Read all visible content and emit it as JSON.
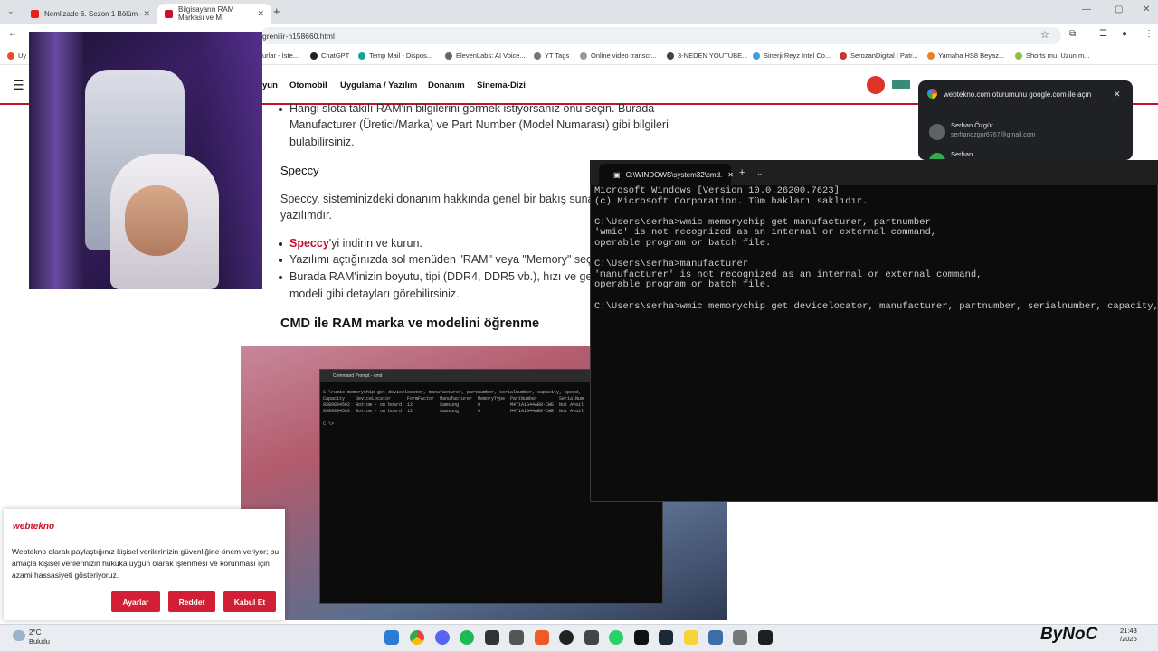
{
  "browser": {
    "tabs": [
      {
        "title": "Nemlizade 6. Sezon 1 Bölüm - ",
        "active": false
      },
      {
        "title": "Bilgisayarın RAM Markası ve M",
        "active": true
      }
    ],
    "url": "grenilir-h158660.html",
    "bookmarks": [
      "Uy",
      "urlar - İste...",
      "ChatGPT",
      "Temp Mail - Dispos...",
      "ElevenLabs: AI Voice...",
      "YT Tags",
      "Online video transcr...",
      "3-NEDEN YOUTUBE...",
      "Sinerji Reyz Intel Co...",
      "SerozanDigital | Patr...",
      "Yamaha HS8 Beyaz...",
      "Shorts mu, Uzun m..."
    ]
  },
  "site": {
    "nav": [
      "yun",
      "Otomobil",
      "Uygulama / Yazılım",
      "Donanım",
      "Sinema-Dizi"
    ],
    "article": {
      "p1_l1": "Hangi slota takılı RAM'in bilgilerini görmek istiyorsanız onu seçin. Burada",
      "p1_l2": "Manufacturer (Üretici/Marka) ve Part Number (Model Numarası) gibi bilgileri",
      "p1_l3": "bulabilirsiniz.",
      "h_speccy": "Speccy",
      "p2_l1": "Speccy, sisteminizdeki donanım hakkında genel bir bakış suna",
      "p2_l2": "yazılımdır.",
      "b1_link": "Speccy",
      "b1_rest": "'yi indirin ve kurun.",
      "b2": "Yazılımı açtığınızda sol menüden \"RAM\" veya \"Memory\" seçe",
      "b3_l1": "Burada RAM'inizin boyutu, tipi (DDR4, DDR5 vb.), hızı ve gen",
      "b3_l2": "modeli gibi detayları görebilirsiniz.",
      "h_cmd": "CMD ile RAM marka ve modelini öğrenme"
    },
    "article_image": {
      "title": "Command Prompt - cmd",
      "lines": [
        "C:\\>wmic memorychip get devicelocator, manufacturer, partnumber, serialnumber, capacity, speed,",
        "Capacity    DeviceLocator      FormFactor  Manufacturer  MemoryType  PartNumber        SerialNum",
        "8589934592  Bottom - on board  12          Samsung       0           M471A1G44AB0-CWE  Not Avail",
        "8589934592  Bottom - on board  12          Samsung       0           M471A1G44AB0-CWE  Not Avail",
        "",
        "C:\\>"
      ]
    }
  },
  "terminal": {
    "tab_title": "C:\\WINDOWS\\system32\\cmd.",
    "lines": [
      "Microsoft Windows [Version 10.0.26200.7623]",
      "(c) Microsoft Corporation. Tüm hakları saklıdır.",
      "",
      "C:\\Users\\serha>wmic memorychip get manufacturer, partnumber",
      "'wmic' is not recognized as an internal or external command,",
      "operable program or batch file.",
      "",
      "C:\\Users\\serha>manufacturer",
      "'manufacturer' is not recognized as an internal or external command,",
      "operable program or batch file.",
      "",
      "C:\\Users\\serha>wmic memorychip get devicelocator, manufacturer, partnumber, serialnumber, capacity, spe"
    ]
  },
  "google_popup": {
    "title": "webtekno.com oturumunu google.com ile açın",
    "accounts": [
      {
        "name": "Serhan Özgür",
        "email": "serhanozgur6767@gmail.com"
      },
      {
        "name": "Serhan",
        "email": ""
      }
    ]
  },
  "cookie": {
    "logo": "webtekno",
    "text": "Webtekno olarak paylaştığınız kişisel verilerinizin güvenliğine önem veriyor; bu amaçla kişisel verilerinizin hukuka uygun olarak işlenmesi ve korunması için azami hassasiyeti gösteriyoruz.",
    "buttons": [
      "Ayarlar",
      "Reddet",
      "Kabul Et"
    ]
  },
  "taskbar": {
    "temp": "2°C",
    "condition": "Bulutlu",
    "time": "21:43",
    "date": "/2026"
  },
  "watermark": "ByNoC",
  "colors": {
    "brand_red": "#c8102e",
    "terminal_bg": "#0c0c0c"
  }
}
